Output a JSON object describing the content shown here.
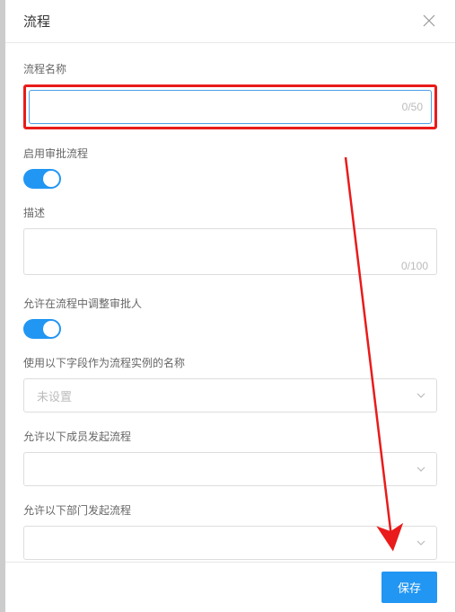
{
  "modal": {
    "title": "流程",
    "fields": {
      "name": {
        "label": "流程名称",
        "value": "",
        "count": "0/50"
      },
      "enable_approval": {
        "label": "启用审批流程",
        "on": true
      },
      "description": {
        "label": "描述",
        "value": "",
        "count": "0/100"
      },
      "allow_adjust_approver": {
        "label": "允许在流程中调整审批人",
        "on": true
      },
      "instance_name_field": {
        "label": "使用以下字段作为流程实例的名称",
        "placeholder": "未设置"
      },
      "allow_members": {
        "label": "允许以下成员发起流程"
      },
      "allow_departments": {
        "label": "允许以下部门发起流程"
      }
    },
    "footer": {
      "save": "保存"
    }
  }
}
